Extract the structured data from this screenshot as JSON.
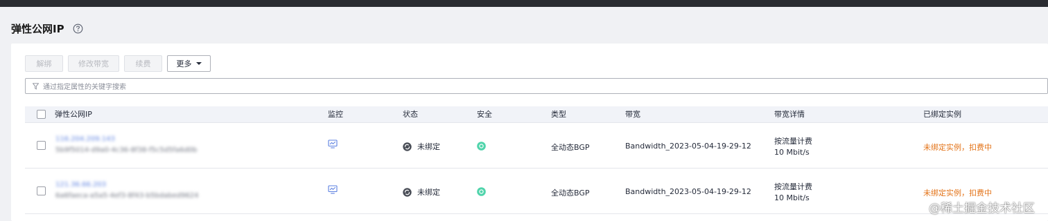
{
  "page": {
    "title": "弹性公网IP"
  },
  "toolbar": {
    "unbind": "解绑",
    "modify_bandwidth": "修改带宽",
    "renew": "续费",
    "more": "更多"
  },
  "search": {
    "placeholder": "通过指定属性的关键字搜索"
  },
  "table": {
    "headers": {
      "eip": "弹性公网IP",
      "monitor": "监控",
      "status": "状态",
      "security": "安全",
      "type": "类型",
      "bandwidth": "带宽",
      "bandwidth_detail": "带宽详情",
      "bound_instance": "已绑定实例"
    },
    "rows": [
      {
        "ip": "116.204.209.143",
        "id": "5b9f5014-d9a0-4c36-8f38-f5c5d5fa6d0b",
        "status": "未绑定",
        "type": "全动态BGP",
        "bandwidth": "Bandwidth_2023-05-04-19-29-12",
        "billing": "按流量计费",
        "speed": "10 Mbit/s",
        "instance": "未绑定实例，扣费中"
      },
      {
        "ip": "121.36.66.203",
        "id": "6a6faeca-a5a5-4ef3-8f43-b5bdabed9624",
        "status": "未绑定",
        "type": "全动态BGP",
        "bandwidth": "Bandwidth_2023-05-04-19-29-12",
        "billing": "按流量计费",
        "speed": "10 Mbit/s",
        "instance": "未绑定实例，扣费中"
      }
    ]
  },
  "watermark": "@稀土掘金技术社区",
  "colors": {
    "link": "#5a7fe0",
    "warning": "#e37318",
    "security_ok": "#50d4ab",
    "header_bg": "#f1f3f8"
  }
}
